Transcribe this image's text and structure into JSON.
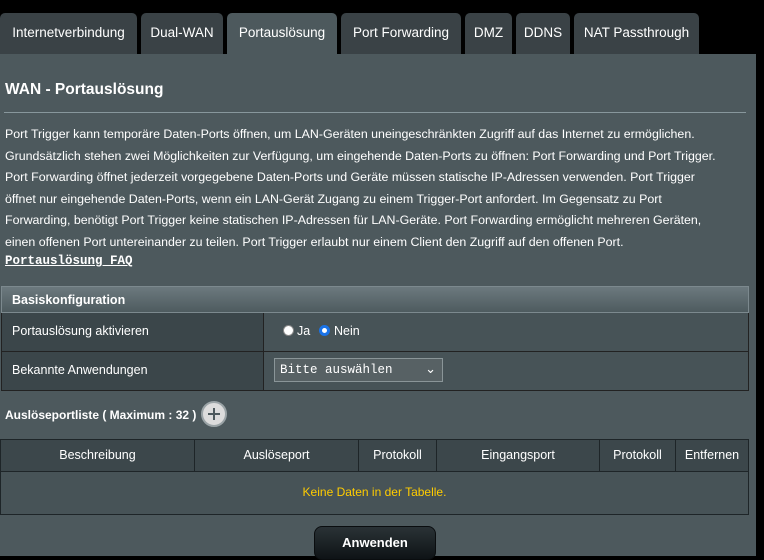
{
  "tabs": [
    {
      "label": "Internetverbindung"
    },
    {
      "label": "Dual-WAN"
    },
    {
      "label": "Portauslösung"
    },
    {
      "label": "Port Forwarding"
    },
    {
      "label": "DMZ"
    },
    {
      "label": "DDNS"
    },
    {
      "label": "NAT Passthrough"
    }
  ],
  "page": {
    "title": "WAN - Portauslösung",
    "description_lines": [
      "Port Trigger kann temporäre Daten-Ports öffnen, um LAN-Geräten uneingeschränkten Zugriff auf das Internet zu ermöglichen.",
      "Grundsätzlich stehen zwei Möglichkeiten zur Verfügung, um eingehende Daten-Ports zu öffnen: Port Forwarding und Port Trigger.",
      "Port Forwarding öffnet jederzeit vorgegebene Daten-Ports und Geräte müssen statische IP-Adressen verwenden. Port Trigger",
      "öffnet nur eingehende Daten-Ports, wenn ein LAN-Gerät Zugang zu einem Trigger-Port anfordert. Im Gegensatz zu Port",
      "Forwarding, benötigt Port Trigger keine statischen IP-Adressen für LAN-Geräte. Port Forwarding ermöglicht mehreren Geräten,",
      "einen offenen Port untereinander zu teilen. Port Trigger erlaubt nur einem Client den Zugriff auf den offenen Port."
    ],
    "faq_link": "Portauslösung FAQ"
  },
  "basic_config": {
    "header": "Basiskonfiguration",
    "enable_label": "Portauslösung aktivieren",
    "option_yes": "Ja",
    "option_no": "Nein",
    "selected": "Nein",
    "apps_label": "Bekannte Anwendungen",
    "apps_selected": "Bitte auswählen"
  },
  "trigger_list": {
    "title": "Auslöseportliste ( Maximum : 32 )",
    "columns": [
      "Beschreibung",
      "Auslöseport",
      "Protokoll",
      "Eingangsport",
      "Protokoll",
      "Entfernen"
    ],
    "empty_text": "Keine Daten in der Tabelle."
  },
  "apply_label": "Anwenden",
  "colors": {
    "panel": "#4d595d",
    "empty_text": "#ffcc00",
    "radio_selected": "#1a73e8"
  }
}
